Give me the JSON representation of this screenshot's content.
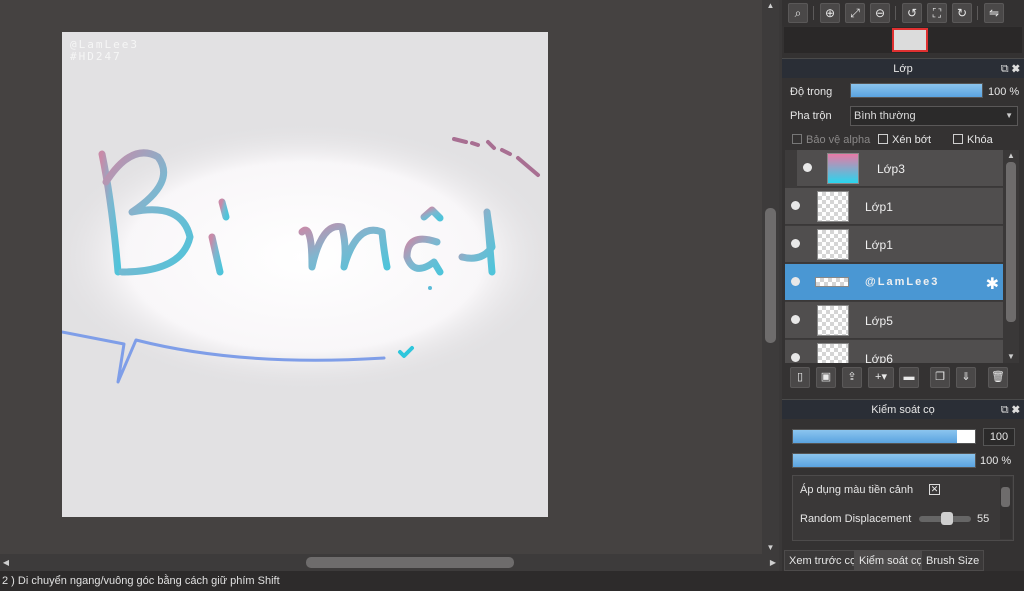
{
  "canvas": {
    "watermark_line1": "@LamLee3",
    "watermark_line2": "#HD247",
    "artwork_text": "Bí mât"
  },
  "status_bar": {
    "text": "2 )  Di chuyển ngang/vuông góc bằng cách giữ phím Shift"
  },
  "layers_panel": {
    "title": "Lớp",
    "opacity_label": "Độ trong",
    "opacity_value": "100 %",
    "opacity_fraction": 1.0,
    "blend_label": "Pha trộn",
    "blend_value": "Bình thường",
    "protect_alpha_label": "Bảo vệ alpha",
    "clipping_label": "Xén bớt",
    "lock_label": "Khóa",
    "layers": [
      {
        "name": "Lớp3",
        "selected": false
      },
      {
        "name": "Lớp1",
        "selected": false
      },
      {
        "name": "Lớp1",
        "selected": false
      },
      {
        "name": "@LamLee3",
        "selected": true
      },
      {
        "name": "Lớp5",
        "selected": false
      },
      {
        "name": "Lớp6",
        "selected": false
      }
    ]
  },
  "brush_control_panel": {
    "title": "Kiểm soát cọ",
    "size_value": "100",
    "size_fraction": 0.9,
    "opacity_value": "100 %",
    "opacity_fraction": 1.0,
    "apply_fg_color_label": "Áp dụng màu tiền cảnh",
    "random_displacement_label": "Random Displacement",
    "random_displacement_value": "55",
    "tabs": [
      "Xem trước cọ",
      "Kiểm soát cọ",
      "Brush Size"
    ],
    "active_tab": "Kiểm soát cọ"
  },
  "colors": {
    "accent": "#4a97d3",
    "slider_fill": "#6fb3e8",
    "layer3_gradient_top": "#e87aa6",
    "layer3_gradient_bottom": "#29d6ee"
  }
}
